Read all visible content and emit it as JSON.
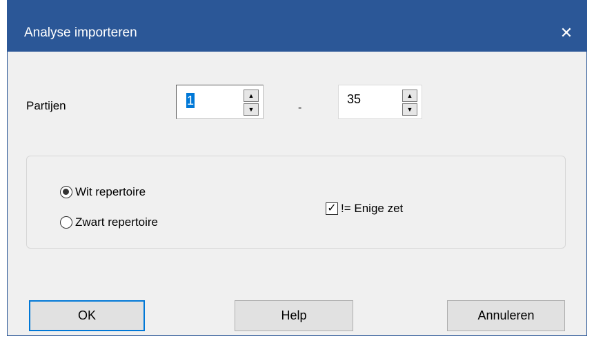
{
  "window": {
    "title": "Analyse importeren",
    "close_glyph": "✕"
  },
  "partijen": {
    "label": "Partijen",
    "from_value": "1",
    "separator": "-",
    "to_value": "35"
  },
  "options": {
    "radio_white": "Wit repertoire",
    "radio_black": "Zwart repertoire",
    "selected": "Wit repertoire",
    "checkbox_label": "!= Enige zet",
    "checkbox_checked": true
  },
  "buttons": {
    "ok": "OK",
    "help": "Help",
    "cancel": "Annuleren"
  },
  "icons": {
    "spin_up": "▲",
    "spin_down": "▼",
    "check": "✓"
  },
  "colors": {
    "titlebar": "#2b5797",
    "selection": "#0078d7",
    "dialog_bg": "#f0f0f0"
  }
}
